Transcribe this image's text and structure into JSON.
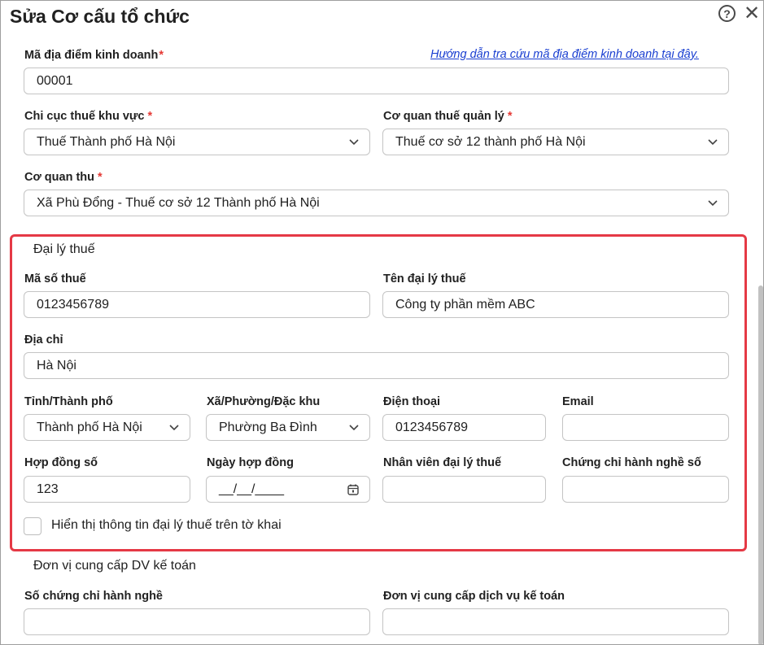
{
  "dialog": {
    "title": "Sửa Cơ cấu tổ chức",
    "help_icon": "?",
    "close_icon": "✕"
  },
  "business_location": {
    "label": "Mã địa điểm kinh doanh",
    "required": "*",
    "value": "00001",
    "guide_link": "Hướng dẫn tra cứu mã địa điểm kinh doanh tại đây."
  },
  "tax_branch": {
    "label": "Chi cục thuế khu vực",
    "required": "*",
    "value": "Thuế Thành phố Hà Nội"
  },
  "tax_office": {
    "label": "Cơ quan thuế quản lý",
    "required": "*",
    "value": "Thuế cơ sở 12 thành phố Hà Nội"
  },
  "collecting_agency": {
    "label": "Cơ quan thu",
    "required": "*",
    "value": "Xã Phù Đổng - Thuế cơ sở 12 Thành phố Hà Nội"
  },
  "tax_agent": {
    "section_title": "Đại lý thuế",
    "tax_code_label": "Mã số thuế",
    "tax_code_value": "0123456789",
    "agent_name_label": "Tên đại lý thuế",
    "agent_name_value": "Công ty phần mềm ABC",
    "address_label": "Địa chỉ",
    "address_value": "Hà Nội",
    "province_label": "Tỉnh/Thành phố",
    "province_value": "Thành phố Hà Nội",
    "ward_label": "Xã/Phường/Đặc khu",
    "ward_value": "Phường Ba Đình",
    "phone_label": "Điện thoại",
    "phone_value": "0123456789",
    "email_label": "Email",
    "email_value": "",
    "contract_no_label": "Hợp đồng số",
    "contract_no_value": "123",
    "contract_date_label": "Ngày hợp đồng",
    "contract_date_placeholder": "__/__/____",
    "staff_label": "Nhân viên đại lý thuế",
    "staff_value": "",
    "cert_label": "Chứng chỉ hành nghề số",
    "cert_value": "",
    "show_on_declaration_label": "Hiển thị thông tin đại lý thuế trên tờ khai",
    "show_on_declaration_checked": false
  },
  "accounting_provider": {
    "section_title": "Đơn vị cung cấp DV kế toán",
    "cert_no_label": "Số chứng chỉ hành nghề",
    "cert_no_value": "",
    "provider_label": "Đơn vị cung cấp dịch vụ kế toán",
    "provider_value": ""
  },
  "colors": {
    "required": "#e53935",
    "link": "#1a3fd1",
    "highlight": "#e53945",
    "border": "#c4c4c4"
  },
  "icons": {
    "dropdown": "chevron-down-icon",
    "date": "calendar-icon"
  }
}
